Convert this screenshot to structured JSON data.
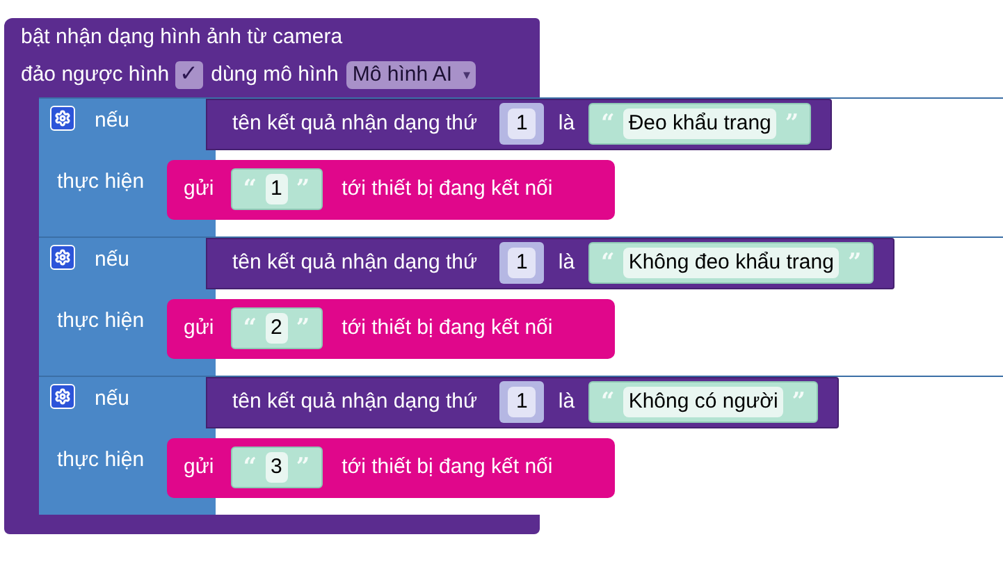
{
  "block": {
    "title": "bật nhận dạng hình ảnh từ camera",
    "flip_label": "đảo ngược hình",
    "flip_mark": "✓",
    "flip_checked": true,
    "model_label": "dùng mô hình",
    "model_value": "Mô hình AI",
    "model_arrow": "▾",
    "rules": [
      {
        "if_label": "nếu",
        "do_label": "thực hiện",
        "condition_text": "tên kết quả nhận dạng thứ",
        "index": "1",
        "is_label": "là",
        "quote_open": "“",
        "value": "Đeo khẩu trang",
        "quote_close": "”",
        "send_label": "gửi",
        "send_quote_open": "“",
        "send_value": "1",
        "send_quote_close": "”",
        "send_suffix": "tới thiết bị đang kết nối"
      },
      {
        "if_label": "nếu",
        "do_label": "thực hiện",
        "condition_text": "tên kết quả nhận dạng thứ",
        "index": "1",
        "is_label": "là",
        "quote_open": "“",
        "value": "Không đeo khẩu trang",
        "quote_close": "”",
        "send_label": "gửi",
        "send_quote_open": "“",
        "send_value": "2",
        "send_quote_close": "”",
        "send_suffix": "tới thiết bị đang kết nối"
      },
      {
        "if_label": "nếu",
        "do_label": "thực hiện",
        "condition_text": "tên kết quả nhận dạng thứ",
        "index": "1",
        "is_label": "là",
        "quote_open": "“",
        "value": "Không có người",
        "quote_close": "”",
        "send_label": "gửi",
        "send_quote_open": "“",
        "send_value": "3",
        "send_quote_close": "”",
        "send_suffix": "tới thiết bị đang kết nối"
      }
    ]
  }
}
